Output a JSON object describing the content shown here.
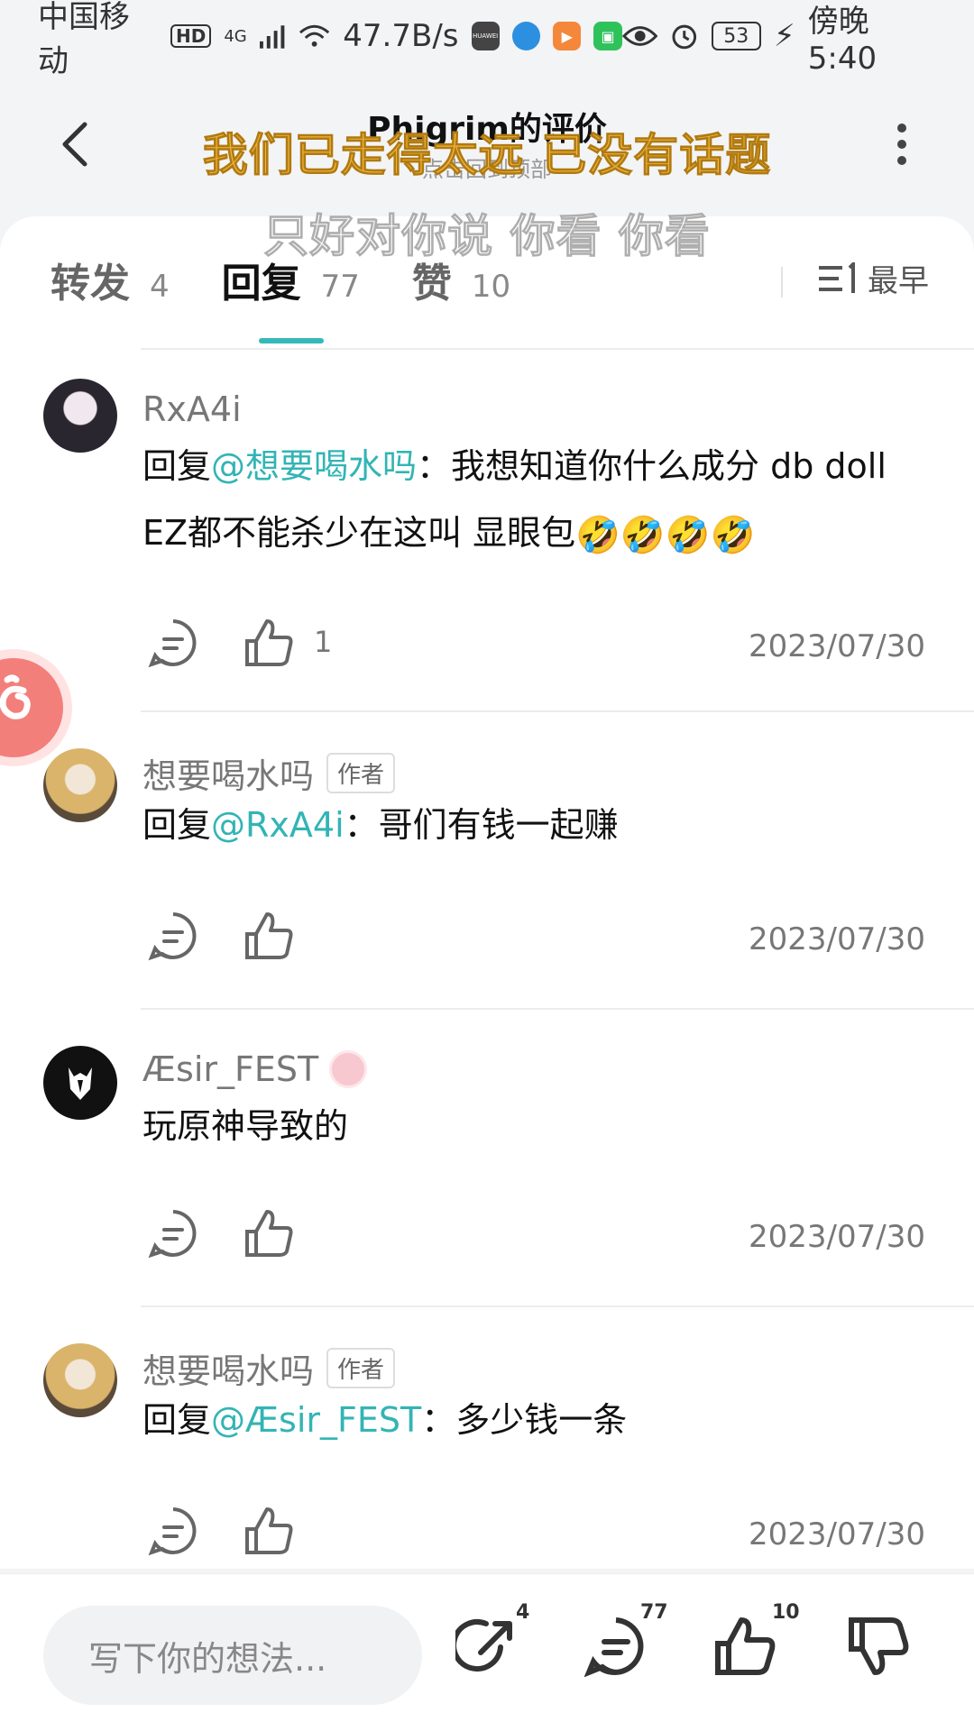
{
  "status_bar": {
    "carrier": "中国移动",
    "hd": "HD",
    "network": "4G",
    "speed": "47.7B/s",
    "battery": "53",
    "time": "傍晚5:40",
    "app_icon_huawei": "HUAWEI"
  },
  "header": {
    "title": "Phigrim的评价",
    "subtitle": "点击回到顶部"
  },
  "lyrics": {
    "line1": "我们已走得太远 已没有话题",
    "line2": "只好对你说 你看 你看"
  },
  "tabs": [
    {
      "label": "转发",
      "count": "4"
    },
    {
      "label": "回复",
      "count": "77"
    },
    {
      "label": "赞",
      "count": "10"
    }
  ],
  "sort": {
    "label": "最早"
  },
  "comments": [
    {
      "user": "RxA4i",
      "prefix": "回复",
      "mention": "@想要喝水吗",
      "text": "：我想知道你什么成分 db doll EZ都不能杀少在这叫 显眼包",
      "emoji": "🤣🤣🤣🤣",
      "likes": "1",
      "date": "2023/07/30"
    },
    {
      "user": "想要喝水吗",
      "badge": "作者",
      "prefix": "回复",
      "mention": "@RxA4i",
      "text": "：哥们有钱一起赚",
      "date": "2023/07/30"
    },
    {
      "user": "Æsir_FEST",
      "text": "玩原神导致的",
      "date": "2023/07/30"
    },
    {
      "user": "想要喝水吗",
      "badge": "作者",
      "prefix": "回复",
      "mention": "@Æsir_FEST",
      "text": "：多少钱一条",
      "date": "2023/07/30"
    }
  ],
  "bottom_bar": {
    "placeholder": "写下你的想法...",
    "share_count": "4",
    "comment_count": "77",
    "like_count": "10"
  },
  "colors": {
    "accent": "#33b4b5",
    "lyric_yellow": "#f0b540",
    "float_icon": "#f37f7b"
  },
  "icons": [
    "back-arrow-icon",
    "more-vertical-icon",
    "sort-icon",
    "reply-icon",
    "thumbs-up-icon",
    "share-icon",
    "comment-icon",
    "thumbs-down-icon"
  ]
}
